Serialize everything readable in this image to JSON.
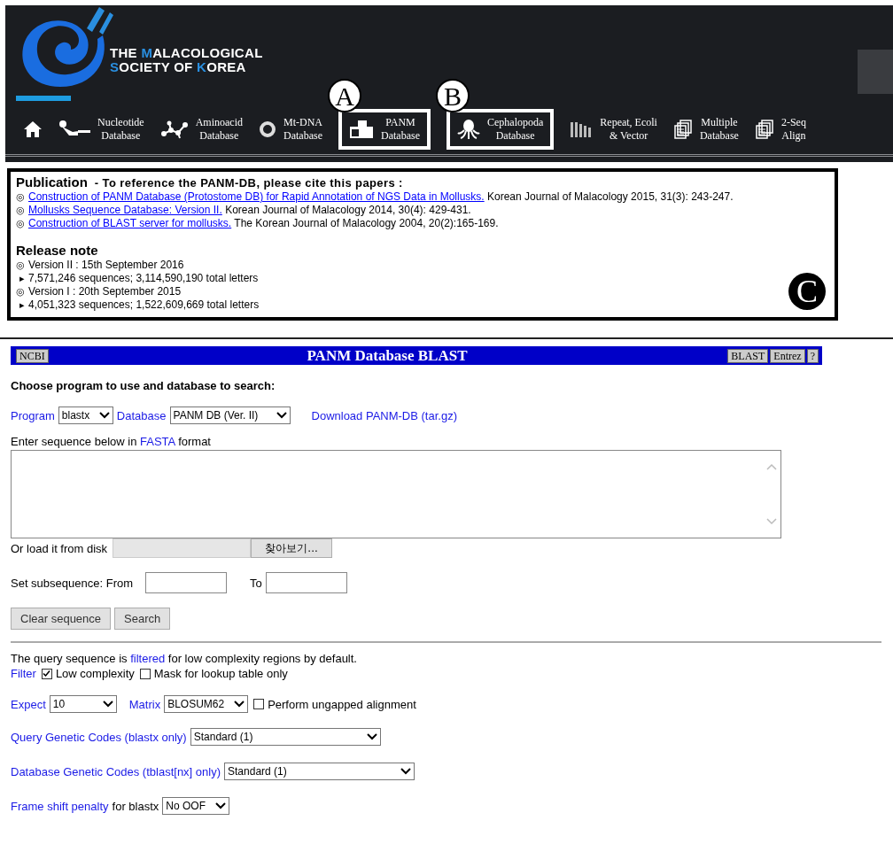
{
  "header": {
    "logo": {
      "lines": [
        [
          {
            "text": "THE ",
            "accent": false
          },
          {
            "text": "M",
            "accent": true
          },
          {
            "text": "ALACOLOGICAL",
            "accent": false
          }
        ],
        [
          {
            "text": "S",
            "accent": true
          },
          {
            "text": "OCIETY OF ",
            "accent": false
          },
          {
            "text": "K",
            "accent": true
          },
          {
            "text": "OREA",
            "accent": false
          }
        ]
      ]
    },
    "nav": [
      {
        "kind": "home"
      },
      {
        "kind": "nucleotide",
        "label": "Nucleotide\nDatabase"
      },
      {
        "kind": "aminoacid",
        "label": "Aminoacid\nDatabase"
      },
      {
        "kind": "mtdna",
        "label": "Mt-DNA\nDatabase"
      },
      {
        "kind": "panm",
        "label": "PANM\nDatabase",
        "callout": "A"
      },
      {
        "kind": "cephalopoda",
        "label": "Cephalopoda\nDatabase",
        "callout": "B"
      },
      {
        "kind": "repeat",
        "label": "Repeat, Ecoli\n& Vector"
      },
      {
        "kind": "multiple",
        "label": "Multiple\nDatabase"
      },
      {
        "kind": "align",
        "label": "2-Seq\nAlign"
      }
    ]
  },
  "publication": {
    "title": "Publication",
    "subtitle": "- To reference the PANM-DB, please cite this papers :",
    "callout": "C",
    "papers": [
      {
        "marker": "◎",
        "link": "Construction of PANM Database (Protostome DB) for Rapid Annotation of NGS Data in Mollusks.",
        "citation": "Korean Journal of Malacology 2015, 31(3): 243-247."
      },
      {
        "marker": "◎",
        "link": "Mollusks Sequence Database: Version II.",
        "citation": "Korean Journal of Malacology 2014, 30(4): 429-431."
      },
      {
        "marker": "◎",
        "link": "Construction of BLAST server for mollusks.",
        "citation": "The Korean Journal of Malacology 2004, 20(2):165-169."
      }
    ],
    "release_title": "Release note",
    "releases": [
      {
        "marker": "◎",
        "text": "Version II : 15th September 2016",
        "details": [
          {
            "marker": "▸",
            "text": "7,571,246 sequences; 3,114,590,190 total letters"
          }
        ]
      },
      {
        "marker": "◎",
        "text": "Version I : 20th September 2015",
        "details": [
          {
            "marker": "▸",
            "text": "4,051,323 sequences; 1,522,609,669 total letters"
          }
        ]
      }
    ]
  },
  "blast": {
    "bar": {
      "left_button": "NCBI",
      "title": "PANM Database BLAST",
      "right_buttons": [
        "BLAST",
        "Entrez",
        "?"
      ]
    },
    "intro": "Choose program to use and database to search:",
    "program": {
      "label": "Program",
      "value": "blastx"
    },
    "database": {
      "label": "Database",
      "value": "PANM DB (Ver. II)"
    },
    "download_link": "Download PANM-DB (tar.gz)",
    "sequence_label": {
      "before": "Enter sequence below in",
      "link": "FASTA",
      "after": "format"
    },
    "file": {
      "label": "Or load it from disk",
      "button": "찾아보기..."
    },
    "subsequence": {
      "label": "Set subsequence: From",
      "to_label": "To"
    },
    "buttons": [
      "Clear sequence",
      "Search"
    ],
    "filter_note": {
      "before": "The query sequence is",
      "link": "filtered",
      "after": "for low complexity regions by default."
    },
    "filter": {
      "label": "Filter",
      "options": [
        {
          "label": "Low complexity",
          "checked": true
        },
        {
          "label": "Mask for lookup table only",
          "checked": false
        }
      ]
    },
    "expect": {
      "label": "Expect",
      "value": "10"
    },
    "matrix": {
      "label": "Matrix",
      "value": "BLOSUM62"
    },
    "ungapped": {
      "label": "Perform ungapped alignment",
      "checked": false
    },
    "query_codes": {
      "label": "Query Genetic Codes (blastx only)",
      "value": "Standard (1)"
    },
    "db_codes": {
      "label": "Database Genetic Codes (tblast[nx] only)",
      "value": "Standard (1)"
    },
    "frame_shift": {
      "link": "Frame shift penalty",
      "after": "for blastx",
      "value": "No OOF"
    }
  }
}
